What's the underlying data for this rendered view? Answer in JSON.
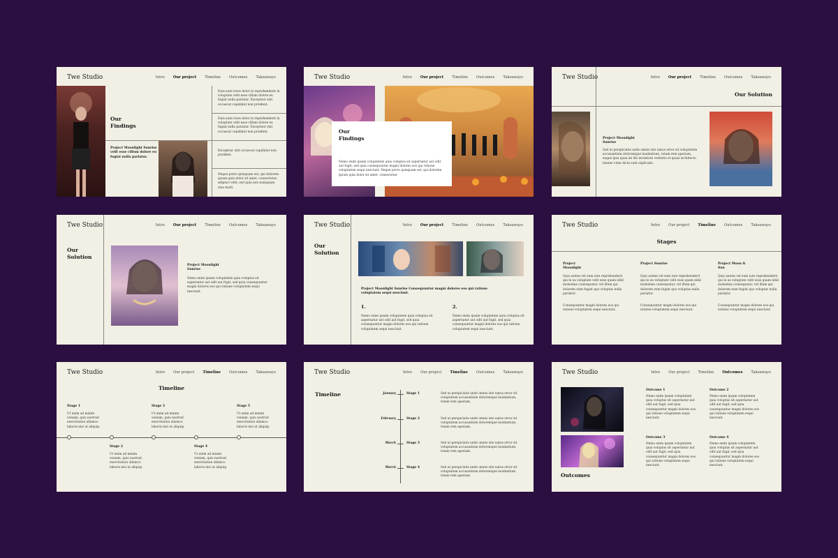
{
  "brand": "Twe Studio",
  "nav": [
    "Intro",
    "Our project",
    "Timeline",
    "Outcomes",
    "Takeaways"
  ],
  "lorem": {
    "duis_a": "Duis aute irure dolor in reprehenderit in voluptate velit esse cillum dolore eu fugiat nulla pariatur. Excepteur sint occaecat cupidatat non proident.",
    "excepteur": "Excepteur sint occaecat cupidatat non proident.",
    "neque": "Neque porro quisquam est, qui dolorem ipsum quia dolor sit amet, consectetur, adipisci velit, sed quia non numquam eius modi.",
    "nemo_long": "Nemo enim ipsam voluptatem quia voluptas sit aspernatur aut odit aut fugit, sed quia consequuntur magni dolores eos qui ratione voluptatem sequi nesciunt. Neque porro quisquam est, qui dolorem ipsum quia dolor sit amet, consectetur",
    "sed_ut": "Sed ut perspiciatis unde omnis iste natus error sit voluptatem accusantium doloremque laudantium, totam rem aperiam, eaque ipsa quae ab illo inventore veritatis et quasi architecto beatae vitae dicta sunt explicabo.",
    "nemo_short": "Nemo enim ipsam voluptatem quia voluptas sit aspernatur aut odit aut fugit, sed quia consequuntur magni dolores eos qui ratione voluptatem sequi nesciunt.",
    "quis": "Quis autem vel eum iure reprehenderit qui in ea voluptate velit esse quam nihil molestiae consequatur, vel illum qui dolorem eum fugiat quo voluptas nulla pariatur.",
    "conseq": "Consequuntur magni dolores eos qui ratione voluptatem sequi nesciunt.",
    "ut_enim": "Ut enim ad minim veniam, quis nostrud exercitation ullamco laboris nisi ut aliquip.",
    "sed_short": "Sed ut perspiciatis unde omnis iste natus error sit voluptatem accusantium doloremque laudantium, totam rem aperiam."
  },
  "s1": {
    "title": "Our Findings",
    "project": "Project Moonlight Sunrise velit esse cillum dolore eu fugiat nulla pariatur."
  },
  "s2": {
    "title": "Our Findings"
  },
  "s3": {
    "title": "Our Solution",
    "project": "Project Moonlight Sunrise"
  },
  "s4": {
    "title": "Our Solution",
    "project": "Project Moonlight Sunrise"
  },
  "s5": {
    "title": "Our Solution",
    "project": "Project Moonlight Sunrise Consequuntur magni dolores eos qui ratione voluptatem sequi nesciunt.",
    "n1": "1.",
    "n2": "2."
  },
  "s6": {
    "title": "Stages",
    "cols": [
      "Project Moonlight",
      "Project Sunrise",
      "Project Moon & Sun"
    ]
  },
  "s7": {
    "title": "Timeline",
    "stages": [
      "Stage 1",
      "Stage 2",
      "Stage 3",
      "Stage 4",
      "Stage 5"
    ]
  },
  "s8": {
    "title": "Timeline",
    "months": [
      "January",
      "February",
      "March",
      "March"
    ],
    "stages": [
      "Stage 1",
      "Stage 2",
      "Stage 3",
      "Stage 4"
    ]
  },
  "s9": {
    "title": "Outcomes",
    "items": [
      "Outcome 1",
      "Outcome 2",
      "Outcome 3",
      "Outcome 4"
    ]
  },
  "colors": {
    "background": "#2a0f40",
    "slide": "#f2efe4"
  }
}
